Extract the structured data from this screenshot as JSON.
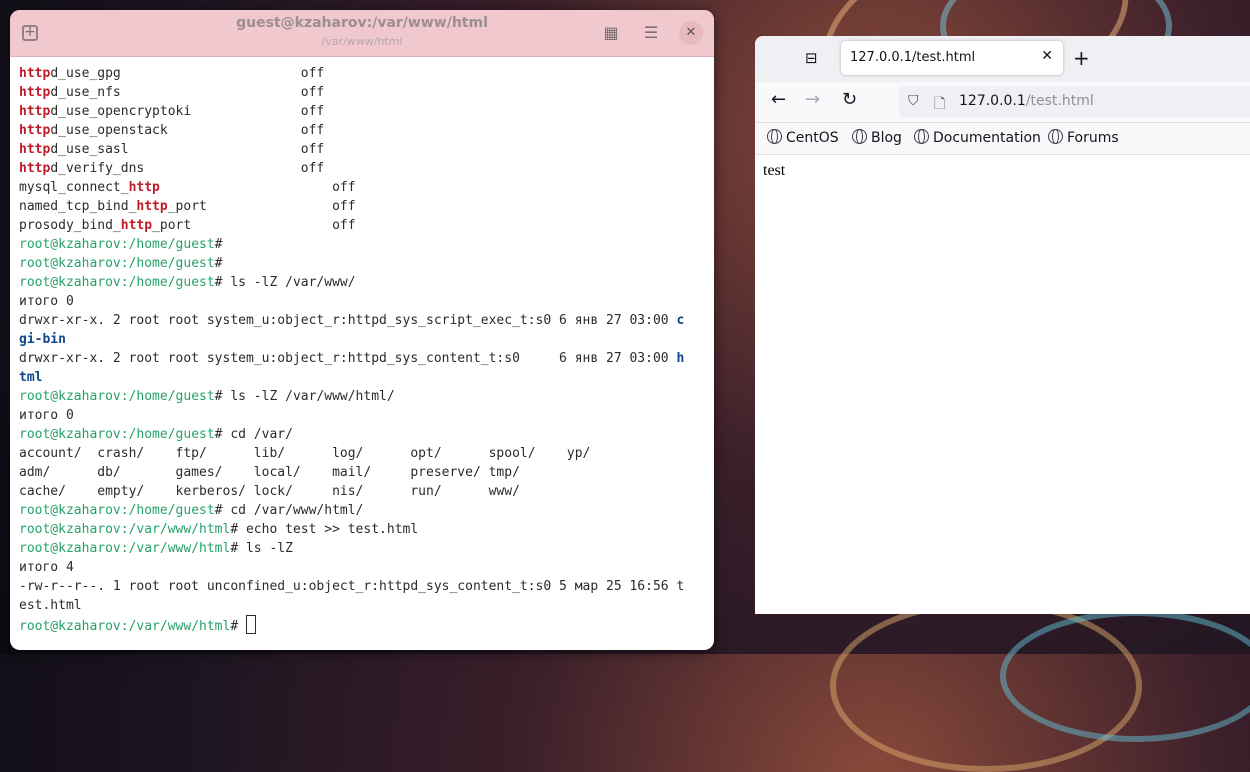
{
  "terminal": {
    "title": "guest@kzaharov:/var/www/html",
    "subtitle": "/var/www/html",
    "lines": [
      [
        {
          "t": "http",
          "c": "hl"
        },
        {
          "t": "d_use_gpg                       off"
        }
      ],
      [
        {
          "t": "http",
          "c": "hl"
        },
        {
          "t": "d_use_nfs                       off"
        }
      ],
      [
        {
          "t": "http",
          "c": "hl"
        },
        {
          "t": "d_use_opencryptoki              off"
        }
      ],
      [
        {
          "t": "http",
          "c": "hl"
        },
        {
          "t": "d_use_openstack                 off"
        }
      ],
      [
        {
          "t": "http",
          "c": "hl"
        },
        {
          "t": "d_use_sasl                      off"
        }
      ],
      [
        {
          "t": "http",
          "c": "hl"
        },
        {
          "t": "d_verify_dns                    off"
        }
      ],
      [
        {
          "t": "mysql_connect_"
        },
        {
          "t": "http",
          "c": "hl"
        },
        {
          "t": "                      off"
        }
      ],
      [
        {
          "t": "named_tcp_bind_"
        },
        {
          "t": "http",
          "c": "hl"
        },
        {
          "t": "_port                off"
        }
      ],
      [
        {
          "t": "prosody_bind_"
        },
        {
          "t": "http",
          "c": "hl"
        },
        {
          "t": "_port                  off"
        }
      ],
      [
        {
          "t": "root@kzaharov",
          "c": "pr"
        },
        {
          "t": ":/home/guest",
          "c": "pr"
        },
        {
          "t": "#"
        }
      ],
      [
        {
          "t": "root@kzaharov",
          "c": "pr"
        },
        {
          "t": ":/home/guest",
          "c": "pr"
        },
        {
          "t": "#"
        }
      ],
      [
        {
          "t": "root@kzaharov",
          "c": "pr"
        },
        {
          "t": ":/home/guest",
          "c": "pr"
        },
        {
          "t": "# ls -lZ /var/www/"
        }
      ],
      [
        {
          "t": "итого 0"
        }
      ],
      [
        {
          "t": "drwxr-xr-x. 2 root root system_u:object_r:httpd_sys_script_exec_t:s0 6 янв 27 03:00 "
        },
        {
          "t": "c",
          "c": "dir"
        }
      ],
      [
        {
          "t": "gi-bin",
          "c": "dir"
        }
      ],
      [
        {
          "t": "drwxr-xr-x. 2 root root system_u:object_r:httpd_sys_content_t:s0     6 янв 27 03:00 "
        },
        {
          "t": "h",
          "c": "dir"
        }
      ],
      [
        {
          "t": "tml",
          "c": "dir"
        }
      ],
      [
        {
          "t": "root@kzaharov",
          "c": "pr"
        },
        {
          "t": ":/home/guest",
          "c": "pr"
        },
        {
          "t": "# ls -lZ /var/www/html/"
        }
      ],
      [
        {
          "t": "итого 0"
        }
      ],
      [
        {
          "t": "root@kzaharov",
          "c": "pr"
        },
        {
          "t": ":/home/guest",
          "c": "pr"
        },
        {
          "t": "# cd /var/"
        }
      ],
      [
        {
          "t": "account/  crash/    ftp/      lib/      log/      opt/      spool/    yp/"
        }
      ],
      [
        {
          "t": "adm/      db/       games/    local/    mail/     preserve/ tmp/"
        }
      ],
      [
        {
          "t": "cache/    empty/    kerberos/ lock/     nis/      run/      www/"
        }
      ],
      [
        {
          "t": "root@kzaharov",
          "c": "pr"
        },
        {
          "t": ":/home/guest",
          "c": "pr"
        },
        {
          "t": "# cd /var/www/html/"
        }
      ],
      [
        {
          "t": "root@kzaharov",
          "c": "pr"
        },
        {
          "t": ":/var/www/html",
          "c": "pr"
        },
        {
          "t": "# echo test >> test.html"
        }
      ],
      [
        {
          "t": "root@kzaharov",
          "c": "pr"
        },
        {
          "t": ":/var/www/html",
          "c": "pr"
        },
        {
          "t": "# ls -lZ"
        }
      ],
      [
        {
          "t": "итого 4"
        }
      ],
      [
        {
          "t": "-rw-r--r--. 1 root root unconfined_u:object_r:httpd_sys_content_t:s0 5 мар 25 16:56 t"
        }
      ],
      [
        {
          "t": "est.html"
        }
      ],
      [
        {
          "t": "root@kzaharov",
          "c": "pr"
        },
        {
          "t": ":/var/www/html",
          "c": "pr"
        },
        {
          "t": "# "
        },
        {
          "t": "",
          "c": "cursor"
        }
      ]
    ]
  },
  "browser": {
    "tab_title": "127.0.0.1/test.html",
    "url_host": "127.0.0.1",
    "url_path": "/test.html",
    "bookmarks": [
      "CentOS",
      "Blog",
      "Documentation",
      "Forums"
    ],
    "page_text": "test"
  },
  "icons": {
    "new_tab": "+",
    "close": "✕",
    "back": "←",
    "forward": "→",
    "reload": "↻",
    "shield": "⛉",
    "page": "🗋",
    "grid": "▦",
    "menu": "☰",
    "tab_list": "⊟"
  }
}
